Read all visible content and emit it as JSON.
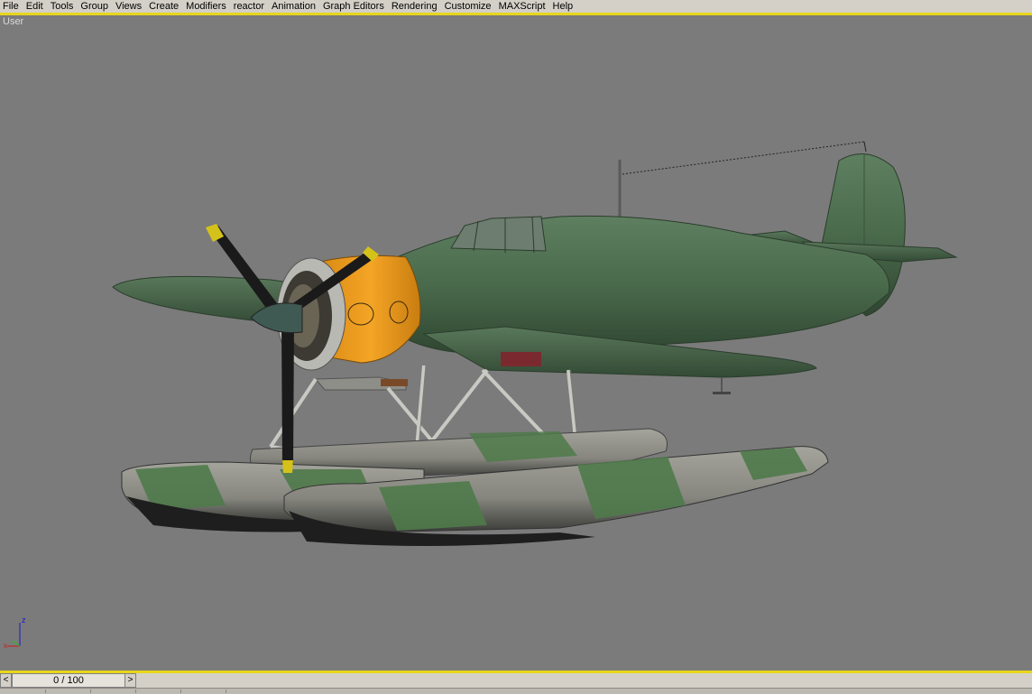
{
  "menu": {
    "items": [
      "File",
      "Edit",
      "Tools",
      "Group",
      "Views",
      "Create",
      "Modifiers",
      "reactor",
      "Animation",
      "Graph Editors",
      "Rendering",
      "Customize",
      "MAXScript",
      "Help"
    ]
  },
  "viewport": {
    "label": "User",
    "background": "#7b7b7b",
    "axis_labels": {
      "z": "z",
      "x": "x"
    }
  },
  "timeline": {
    "frame_display": "0 / 100",
    "prev_glyph": "<",
    "next_glyph": ">"
  },
  "colors": {
    "accent": "#e8d51c",
    "fuselage": "#4b6a4c",
    "cowling": "#f0a020",
    "float_grey": "#8d8d86",
    "float_green": "#4f7a4a"
  }
}
